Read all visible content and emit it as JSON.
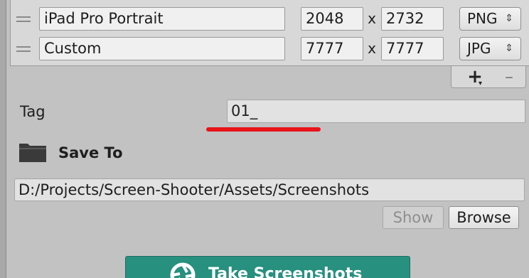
{
  "resolutions": [
    {
      "name": "iPad Pro Portrait",
      "width": "2048",
      "height": "2732",
      "format": "PNG"
    },
    {
      "name": "Custom",
      "width": "7777",
      "height": "7777",
      "format": "JPG"
    }
  ],
  "dimension_separator": "x",
  "format_arrows": "⇕",
  "list_controls": {
    "add_label": "+",
    "add_dot": "▾",
    "remove_label": "–"
  },
  "tag": {
    "label": "Tag",
    "value": "01_"
  },
  "save_to": {
    "label": "Save To",
    "path": "D:/Projects/Screen-Shooter/Assets/Screenshots"
  },
  "buttons": {
    "show": "Show",
    "browse": "Browse",
    "take_screenshots": "Take Screenshots"
  },
  "colors": {
    "accent_button": "#27907f",
    "highlight_underline": "#e8141a"
  }
}
